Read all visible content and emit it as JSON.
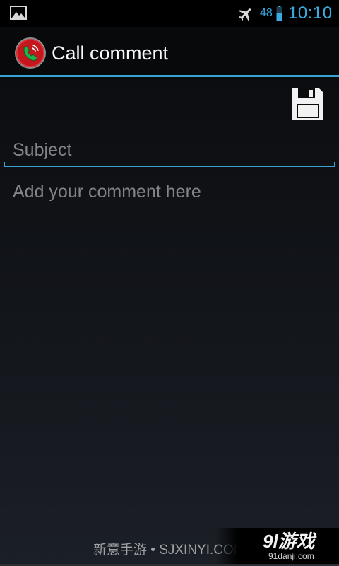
{
  "status_bar": {
    "battery_level": "48",
    "time": "10:10",
    "icons": [
      "gallery-notification-icon",
      "airplane-mode-icon",
      "battery-icon"
    ]
  },
  "action_bar": {
    "title": "Call comment",
    "app_icon": "call-recorder-app-icon"
  },
  "toolbar": {
    "save_icon": "floppy-disk-save-icon"
  },
  "form": {
    "subject": {
      "value": "",
      "placeholder": "Subject"
    },
    "comment": {
      "value": "",
      "placeholder": "Add your comment here"
    }
  },
  "watermark": {
    "left_text": "新意手游 • SJXINYI.COM",
    "brand": "9l游戏",
    "url": "91danji.com"
  },
  "colors": {
    "accent": "#36a3d3",
    "placeholder": "#828486",
    "app_icon_red": "#c4161c",
    "app_icon_green": "#22b04a"
  }
}
